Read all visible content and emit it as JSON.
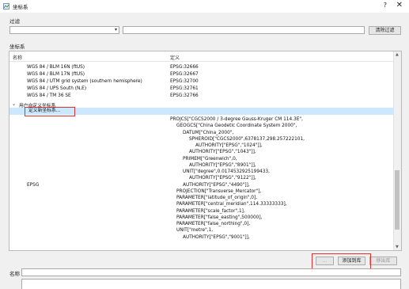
{
  "window": {
    "title": "坐标系",
    "help": "?",
    "close": "✕"
  },
  "filter": {
    "label": "过滤",
    "select_value": "",
    "input_value": "",
    "clear_label": "清除过滤"
  },
  "crs_section": {
    "label": "坐标系"
  },
  "tree": {
    "columns": [
      "名称",
      "定义"
    ],
    "rows": [
      {
        "name": "WGS 84 / BLM 16N (ftUS)",
        "def": "EPSG:32666"
      },
      {
        "name": "WGS 84 / BLM 17N (ftUS)",
        "def": "EPSG:32667"
      },
      {
        "name": "WGS 84 / UTM grid system (southern hemisphere)",
        "def": "EPSG:32700"
      },
      {
        "name": "WGS 84 / UPS South (N,E)",
        "def": "EPSG:32761"
      },
      {
        "name": "WGS 84 / TM 36 SE",
        "def": "EPSG:32766"
      }
    ],
    "user_group": "用户自定义坐标系",
    "new_crs": "定义新坐标系...",
    "epsg_label": "EPSG",
    "wkt": [
      "PROJCS[\"CGCS2000 / 3-degree Gauss-Kruger CM 114.3E\",",
      "GEOGCS[\"China Geodetic Coordinate System 2000\",",
      "DATUM[\"China_2000\",",
      "SPHEROID[\"CGCS2000\",6378137,298.257222101,",
      "AUTHORITY[\"EPSG\",\"1024\"]],",
      "AUTHORITY[\"EPSG\",\"1043\"]],",
      "PRIMEM[\"Greenwich\",0,",
      "AUTHORITY[\"EPSG\",\"8901\"]],",
      "UNIT[\"degree\",0.0174532925199433,",
      "AUTHORITY[\"EPSG\",\"9122\"]],",
      "AUTHORITY[\"EPSG\",\"4490\"]],",
      "PROJECTION[\"Transverse_Mercator\"],",
      "PARAMETER[\"latitude_of_origin\",0],",
      "PARAMETER[\"central_meridian\",114.33333333],",
      "PARAMETER[\"scale_factor\",1],",
      "PARAMETER[\"false_easting\",500000],",
      "PARAMETER[\"false_northing\",0],",
      "UNIT[\"metre\",1,",
      "AUTHORITY[\"EPSG\",\"9001\"]],"
    ]
  },
  "actions": {
    "ellipsis": "...",
    "add": "添加到库",
    "remove": "移出库"
  },
  "name_field": {
    "label": "名称",
    "value": ""
  },
  "colors": {
    "highlight": "#e03030",
    "selection": "#cce8ff"
  }
}
